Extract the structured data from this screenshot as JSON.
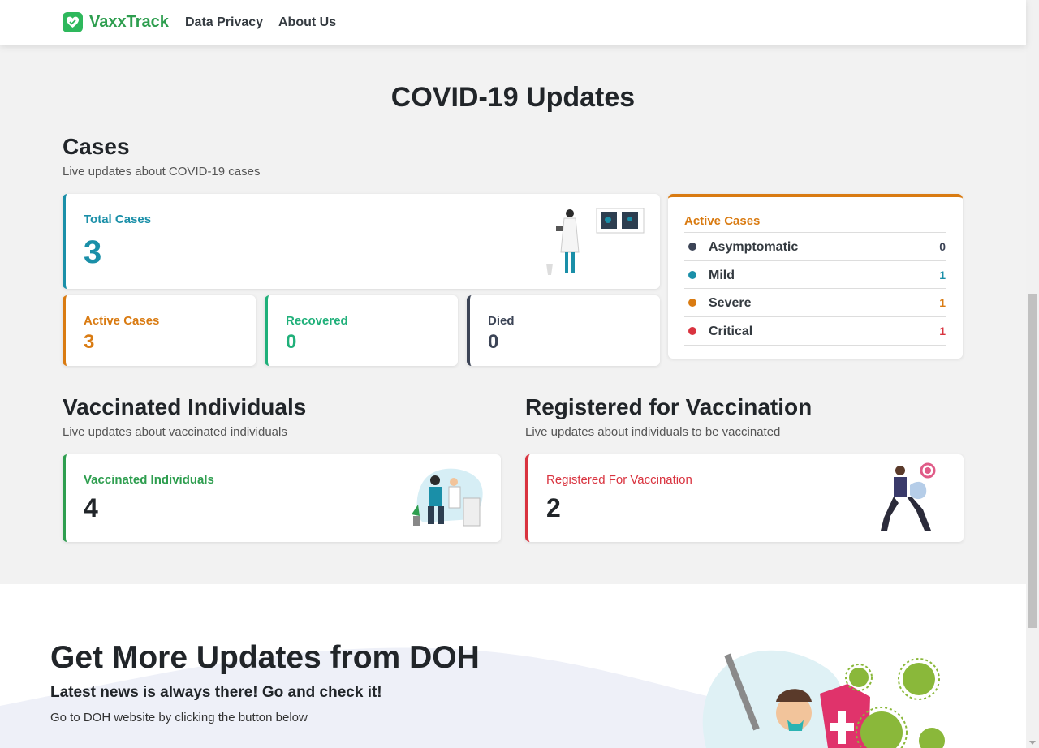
{
  "nav": {
    "brand": "VaxxTrack",
    "links": [
      "Data Privacy",
      "About Us"
    ]
  },
  "page_title": "COVID-19 Updates",
  "cases": {
    "title": "Cases",
    "subtitle": "Live updates about COVID-19 cases",
    "total": {
      "label": "Total Cases",
      "value": "3"
    },
    "active": {
      "label": "Active Cases",
      "value": "3"
    },
    "recovered": {
      "label": "Recovered",
      "value": "0"
    },
    "died": {
      "label": "Died",
      "value": "0"
    },
    "breakdown": {
      "title": "Active Cases",
      "rows": [
        {
          "name": "Asymptomatic",
          "count": "0",
          "color": "#3c4456"
        },
        {
          "name": "Mild",
          "count": "1",
          "color": "#1a8fa8"
        },
        {
          "name": "Severe",
          "count": "1",
          "color": "#d97b12"
        },
        {
          "name": "Critical",
          "count": "1",
          "color": "#d9333f"
        }
      ]
    }
  },
  "vaccinated": {
    "title": "Vaccinated Individuals",
    "subtitle": "Live updates about vaccinated individuals",
    "card_label": "Vaccinated Individuals",
    "value": "4"
  },
  "registered": {
    "title": "Registered for Vaccination",
    "subtitle": "Live updates about individuals to be vaccinated",
    "card_label": "Registered For Vaccination",
    "value": "2"
  },
  "doh": {
    "title": "Get More Updates from DOH",
    "subtitle": "Latest news is always there! Go and check it!",
    "description": "Go to DOH website by clicking the button below"
  },
  "colors": {
    "brand": "#2e9e4f",
    "total": "#1a8fa8",
    "active": "#d97b12",
    "recovered": "#20b07a",
    "died": "#3c4456",
    "registered": "#d9333f"
  },
  "icons": {
    "logo": "heart-shield-icon"
  }
}
